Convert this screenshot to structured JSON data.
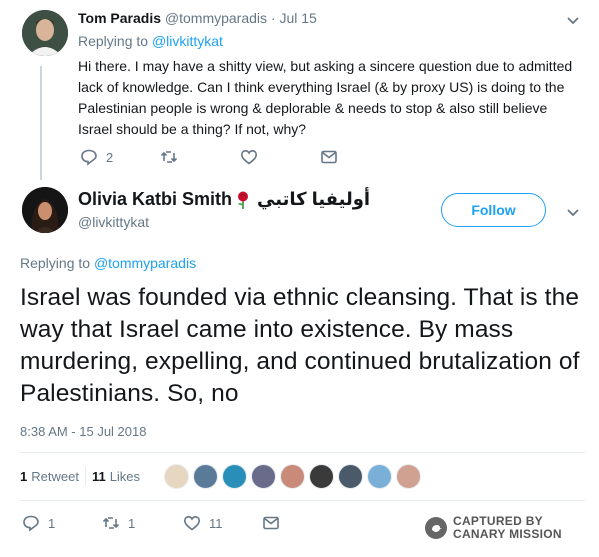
{
  "reply": {
    "name": "Tom Paradis",
    "handle": "@tommyparadis",
    "time": "Jul 15",
    "replying_prefix": "Replying to",
    "replying_to": "@livkittykat",
    "text": "Hi there. I may have a shitty view, but asking a sincere question due to admitted lack of knowledge. Can I think everything Israel (& by proxy US) is doing to the Palestinian people is wrong & deplorable & needs to stop & also still believe Israel should be a thing? If not, why?",
    "reply_count": "2",
    "retweet_count": "",
    "like_count": ""
  },
  "main": {
    "name": "Olivia Katbi Smith",
    "name_arabic": "أوليفيا كاتبي",
    "handle": "@livkittykat",
    "follow_label": "Follow",
    "replying_prefix": "Replying to",
    "replying_to": "@tommyparadis",
    "text": "Israel was founded via ethnic cleansing. That is the way that Israel came into existence. By mass murdering, expelling, and continued brutalization of Palestinians. So, no",
    "timestamp": "8:38 AM - 15 Jul 2018",
    "retweets_num": "1",
    "retweets_label": "Retweet",
    "likes_num": "11",
    "likes_label": "Likes",
    "reply_count": "1",
    "retweet_count": "1",
    "like_count": "11"
  },
  "watermark": {
    "line1": "CAPTURED BY",
    "line2": "CANARY MISSION"
  },
  "likers": [
    "#e8d7c0",
    "#5a7a9a",
    "#2a8fb8",
    "#6a6a8a",
    "#c98a7a",
    "#3a3a3a",
    "#4a5a6a",
    "#7ab0d8",
    "#d0a090"
  ],
  "colors": {
    "accent": "#1da1f2",
    "muted": "#657786",
    "text": "#14171a"
  }
}
